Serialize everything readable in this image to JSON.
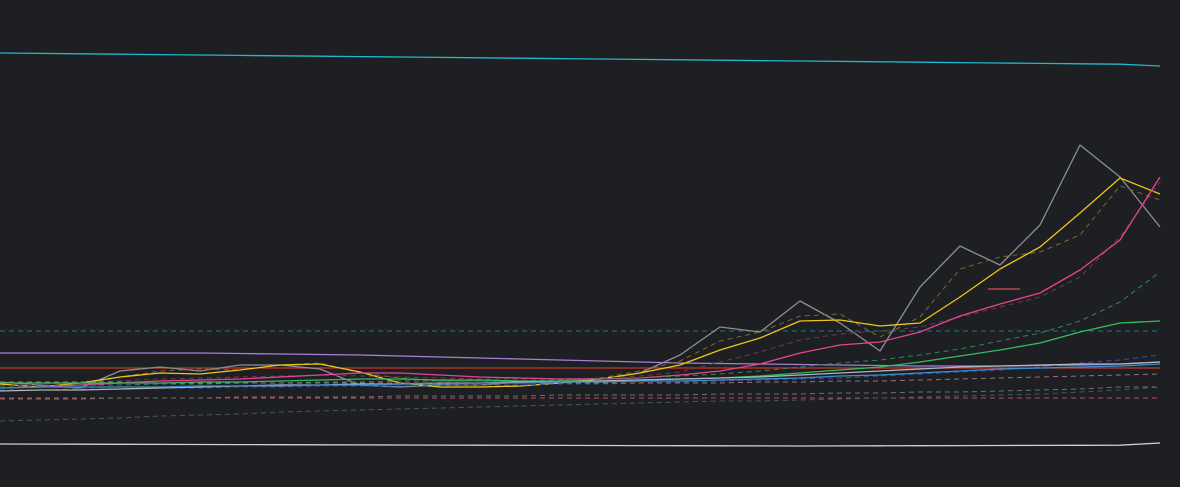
{
  "chart_data": {
    "type": "line",
    "background": "#1e1f22",
    "grid": false,
    "legend": "none",
    "xlim": [
      0,
      29
    ],
    "ylim": [
      -20,
      467
    ],
    "x": [
      0,
      1,
      2,
      3,
      4,
      5,
      6,
      7,
      8,
      9,
      10,
      11,
      12,
      13,
      14,
      15,
      16,
      17,
      18,
      19,
      20,
      21,
      22,
      23,
      24,
      25,
      26,
      27,
      28,
      29
    ],
    "series": [
      {
        "color": "#22b8cf",
        "style": "solid",
        "values": [
          414,
          413.6,
          413.2,
          412.8,
          412.4,
          412,
          411.6,
          411.2,
          410.8,
          410.4,
          410,
          409.6,
          409.2,
          408.8,
          408.4,
          408,
          407.6,
          407.2,
          406.8,
          406.4,
          406,
          405.6,
          405.2,
          404.8,
          404.4,
          404,
          403.6,
          403.2,
          402.8,
          401
        ]
      },
      {
        "color": "#d0d0d0",
        "style": "solid",
        "values": [
          23,
          22.9,
          22.8,
          22.7,
          22.6,
          22.5,
          22.4,
          22.3,
          22.2,
          22.1,
          22,
          21.9,
          21.8,
          21.7,
          21.6,
          21.5,
          21.4,
          21.3,
          21.2,
          21.1,
          21,
          21.1,
          21.2,
          21.3,
          21.4,
          21.5,
          21.6,
          21.7,
          21.8,
          24
        ]
      },
      {
        "color": "#1e7a85",
        "style": "dashed",
        "values": [
          136,
          136,
          136,
          136,
          136,
          136,
          136,
          136,
          136,
          136,
          136,
          136,
          136,
          136,
          136,
          136,
          136,
          136,
          136,
          136,
          136,
          136,
          136,
          136,
          136,
          136,
          136,
          136,
          136,
          136
        ]
      },
      {
        "color": "#a87dd8",
        "style": "solid",
        "values": [
          114,
          114,
          114,
          114,
          114,
          114,
          113.5,
          113,
          112.5,
          112,
          111,
          110,
          109,
          108,
          107,
          106,
          105,
          104,
          103.5,
          103,
          102.5,
          102,
          101.5,
          101,
          101,
          101,
          101.5,
          102,
          103,
          105
        ]
      },
      {
        "color": "#c0392b",
        "style": "solid",
        "values": [
          99,
          99,
          99,
          99,
          99,
          99,
          99,
          99,
          99,
          99,
          99,
          99,
          99,
          99,
          99,
          99,
          99,
          99,
          99,
          99,
          99,
          99,
          99,
          99,
          99,
          99,
          99,
          99,
          99,
          99
        ]
      },
      {
        "color": "#b94a5a",
        "style": "dashed",
        "values": [
          69,
          69,
          69,
          69,
          69,
          69,
          69,
          69,
          69,
          69,
          69,
          69,
          69,
          69,
          69,
          69,
          69,
          69,
          69,
          69,
          69,
          69,
          69,
          69,
          69,
          69,
          69,
          69,
          69,
          69
        ]
      },
      {
        "color": "#4b5560",
        "style": "dashed",
        "values": [
          46,
          47,
          48,
          49,
          51,
          52,
          53,
          55,
          56,
          57,
          58,
          59,
          60,
          61,
          62,
          63,
          64,
          65,
          66,
          66,
          67,
          68,
          69,
          70,
          71,
          72,
          73,
          75,
          77,
          80
        ]
      },
      {
        "color": "#8a8f98",
        "style": "solid",
        "values": [
          85,
          82,
          79,
          96,
          100,
          96,
          102,
          102,
          98,
          82,
          80,
          82,
          82,
          85,
          85,
          88,
          94,
          112,
          140,
          135,
          166,
          144,
          116,
          180,
          221,
          202,
          242,
          322,
          290,
          240
        ]
      },
      {
        "color": "#7a6a2a",
        "style": "dashed",
        "values": [
          83,
          80,
          82,
          90,
          96,
          98,
          97,
          102,
          104,
          94,
          89,
          86,
          86,
          85,
          86,
          89,
          96,
          106,
          126,
          135,
          151,
          153,
          130,
          150,
          198,
          210,
          215,
          232,
          281,
          267
        ]
      },
      {
        "color": "#f0c419",
        "style": "solid",
        "values": [
          83,
          80,
          84,
          90,
          94,
          93,
          97,
          102,
          103,
          95,
          84,
          80,
          80,
          81,
          84,
          88,
          94,
          102,
          117,
          129,
          146,
          147,
          141,
          144,
          170,
          198,
          220,
          254,
          289,
          273
        ]
      },
      {
        "color": "#6e3a52",
        "style": "dashed",
        "values": [
          81,
          83,
          84,
          86,
          88,
          89,
          90,
          91,
          92,
          91,
          90,
          89,
          88,
          88,
          88,
          89,
          91,
          95,
          105,
          115,
          127,
          133,
          136,
          140,
          150,
          160,
          170,
          190,
          230,
          285
        ]
      },
      {
        "color": "#e84393",
        "style": "solid",
        "values": [
          79,
          80,
          82,
          84,
          86,
          87,
          88,
          90,
          92,
          94,
          94,
          92,
          90,
          89,
          88,
          88,
          89,
          92,
          96,
          103,
          114,
          122,
          125,
          135,
          151,
          163,
          174,
          197,
          227,
          290
        ]
      },
      {
        "color": "#2e8c4e",
        "style": "dashed",
        "values": [
          81,
          81,
          82,
          82,
          83,
          83,
          84,
          84,
          85,
          85,
          86,
          86,
          86,
          86,
          87,
          88,
          89,
          91,
          93,
          96,
          100,
          104,
          107,
          112,
          118,
          126,
          134,
          146,
          165,
          195
        ]
      },
      {
        "color": "#2fbf60",
        "style": "solid",
        "values": [
          84,
          84,
          84,
          84,
          84,
          85,
          85,
          86,
          87,
          88,
          88,
          87,
          87,
          86,
          86,
          86,
          87,
          88,
          89,
          91,
          94,
          97,
          100,
          105,
          111,
          117,
          124,
          135,
          144,
          146
        ]
      },
      {
        "color": "#3b4fa8",
        "style": "dashed",
        "values": [
          77,
          77,
          78,
          78,
          79,
          79,
          80,
          80,
          81,
          81,
          81,
          82,
          82,
          82,
          83,
          83,
          84,
          85,
          86,
          87,
          88,
          89,
          91,
          93,
          95,
          97,
          100,
          104,
          107,
          112
        ]
      },
      {
        "color": "#b0b4c0",
        "style": "solid",
        "values": [
          76,
          77,
          77,
          78,
          79,
          80,
          81,
          82,
          82,
          83,
          83,
          84,
          84,
          85,
          85,
          86,
          87,
          88,
          89,
          90,
          92,
          94,
          96,
          98,
          100,
          101,
          102,
          103,
          103,
          105
        ]
      },
      {
        "color": "#3a8fd0",
        "style": "solid",
        "values": [
          79,
          80,
          80,
          80,
          80,
          81,
          81,
          81,
          82,
          82,
          83,
          83,
          84,
          84,
          85,
          85,
          86,
          86,
          87,
          88,
          89,
          91,
          92,
          94,
          96,
          98,
          99,
          100,
          101,
          103
        ]
      },
      {
        "color": "#9a7080",
        "style": "dashed",
        "values": [
          85,
          85,
          85,
          85,
          84,
          84,
          84,
          84,
          84,
          84,
          84,
          84,
          84,
          84,
          84,
          84,
          84,
          84,
          84,
          85,
          85,
          86,
          86,
          87,
          88,
          89,
          90,
          91,
          92,
          93
        ]
      },
      {
        "color": "#707070",
        "style": "dashed",
        "values": [
          68,
          68,
          68,
          69,
          69,
          69,
          70,
          70,
          70,
          70,
          71,
          71,
          71,
          71,
          72,
          72,
          72,
          72,
          73,
          73,
          73,
          74,
          74,
          75,
          75,
          76,
          77,
          78,
          80,
          80
        ]
      }
    ],
    "annotation": {
      "color": "#d94b4b",
      "x_from": 24.7,
      "x_to": 25.5,
      "y": 178
    }
  }
}
